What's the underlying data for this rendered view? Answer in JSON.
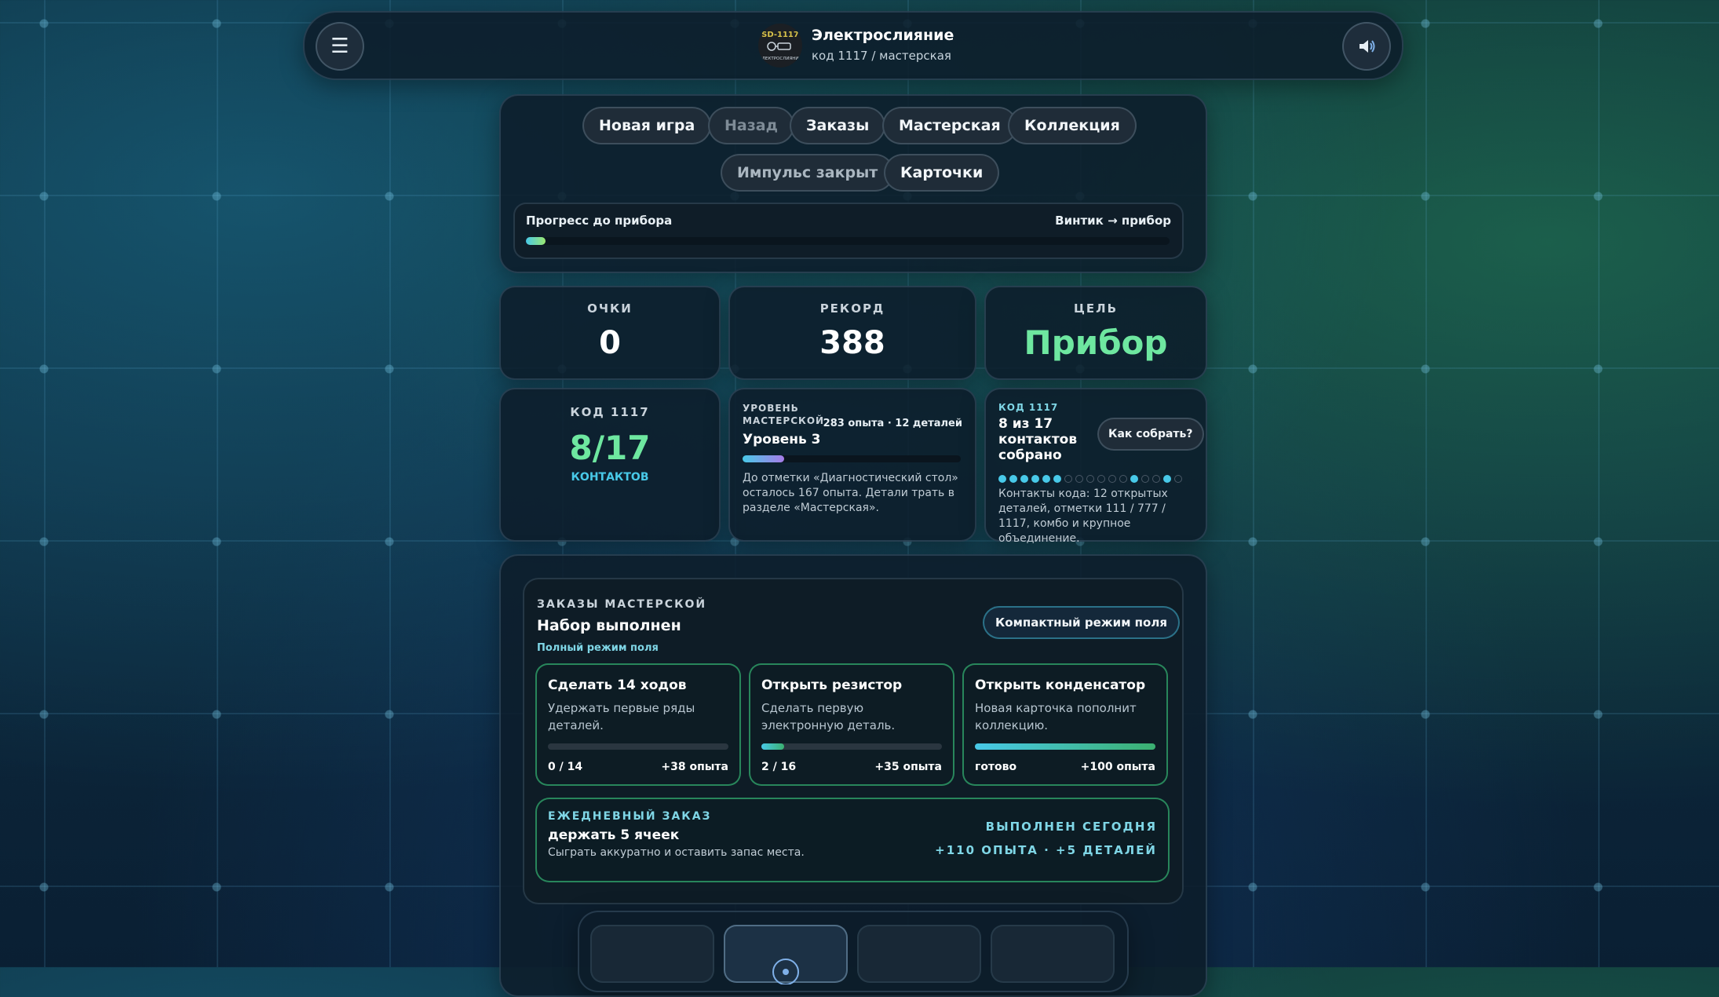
{
  "header": {
    "title": "Электрослияние",
    "subtitle": "код 1117 / мастерская",
    "logo_text_top": "SD-1117",
    "logo_text_bottom": "ЭЛЕКТРОСЛИЯНИЕ",
    "menu_icon": "hamburger-icon",
    "sound_icon": "speaker-icon"
  },
  "nav": {
    "buttons": [
      "Новая игра",
      "Назад",
      "Заказы",
      "Мастерская",
      "Коллекция",
      "Импульс закрыт",
      "Карточки"
    ]
  },
  "progress": {
    "label": "Прогресс до прибора",
    "right_label": "Винтик → прибор",
    "fraction": 0.03
  },
  "stats": {
    "score_label": "ОЧКИ",
    "score_value": "0",
    "record_label": "РЕКОРД",
    "record_value": "388",
    "goal_label": "ЦЕЛЬ",
    "goal_value": "Прибор"
  },
  "code_card": {
    "label": "КОД 1117",
    "value": "8/17",
    "sub": "КОНТАКТОВ"
  },
  "level_card": {
    "label_line1": "УРОВЕНЬ",
    "label_line2": "МАСТЕРСКОЙ",
    "meta": "283 опыта · 12 деталей",
    "level": "Уровень 3",
    "fraction": 0.19,
    "note": "До отметки «Диагностический стол» осталось 167 опыта. Детали трать в разделе «Мастерская»."
  },
  "contacts_card": {
    "label": "КОД 1117",
    "status": "8 из 17 контактов собрано",
    "button": "Как собрать?",
    "dots": [
      1,
      1,
      1,
      1,
      1,
      1,
      0,
      0,
      0,
      0,
      0,
      0,
      1,
      0,
      0,
      1,
      0
    ],
    "note": "Контакты кода: 12 открытых деталей, отметки 111 / 777 / 1117, комбо и крупное объединение."
  },
  "orders": {
    "label": "ЗАКАЗЫ МАСТЕРСКОЙ",
    "title": "Набор выполнен",
    "mode_note": "Полный режим поля",
    "compact_button": "Компактный режим поля",
    "items": [
      {
        "title": "Сделать 14 ходов",
        "desc": "Удержать первые ряды деталей.",
        "left": "0 / 14",
        "right": "+38 опыта",
        "fraction": 0.0
      },
      {
        "title": "Открыть резистор",
        "desc": "Сделать первую электронную деталь.",
        "left": "2 / 16",
        "right": "+35 опыта",
        "fraction": 0.125
      },
      {
        "title": "Открыть конденсатор",
        "desc": "Новая карточка пополнит коллекцию.",
        "left": "готово",
        "right": "+100 опыта",
        "fraction": 1.0
      }
    ]
  },
  "daily": {
    "label": "ЕЖЕДНЕВНЫЙ ЗАКАЗ",
    "title": "держать 5 ячеек",
    "desc": "Сыграть аккуратно и оставить запас места.",
    "status": "ВЫПОЛНЕН СЕГОДНЯ",
    "reward": "+110 ОПЫТА · +5 ДЕТАЛЕЙ"
  },
  "colors": {
    "accent_green": "#6ee7a0",
    "accent_cyan": "#48c9e8",
    "label_teal": "#7fd6e6"
  }
}
